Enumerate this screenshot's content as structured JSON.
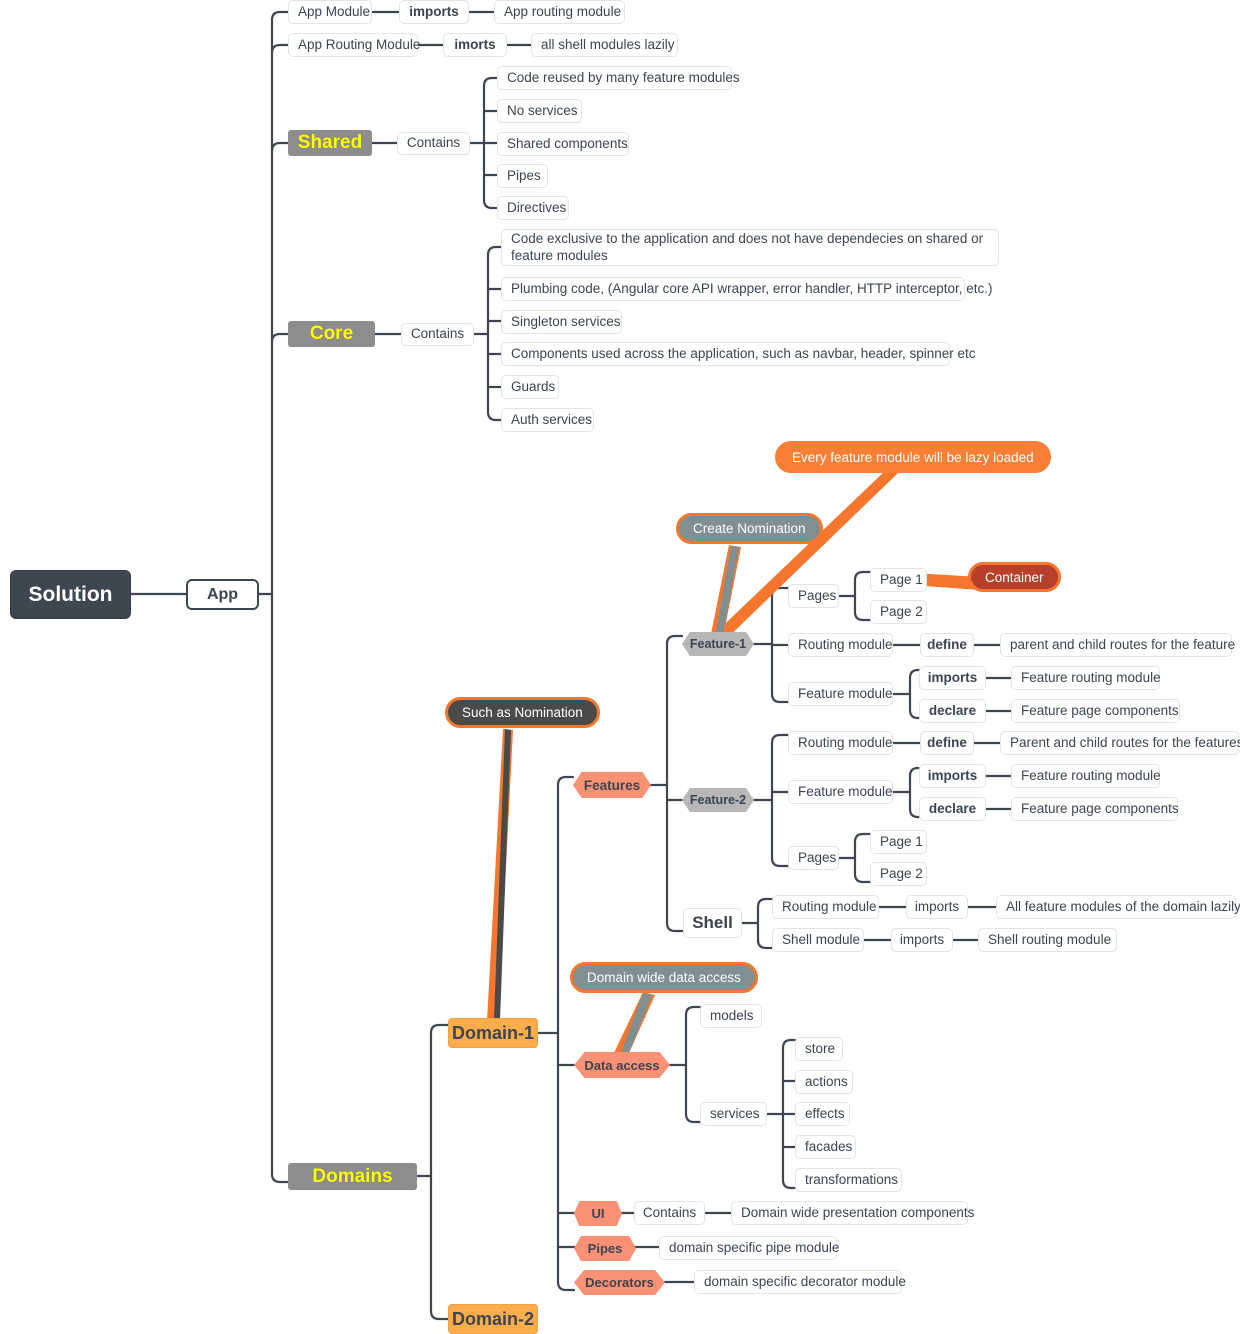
{
  "diagram": {
    "title": "Solution architecture mind map",
    "root": {
      "label": "Solution"
    },
    "app": {
      "label": "App"
    }
  },
  "colors": {
    "accent_orange": "#F5762C",
    "callout_orange": "#F97F37",
    "callout_slate": "#7F8F92",
    "callout_dark": "#4A4A48",
    "callout_brick": "#B7402C",
    "hex_coral": "#FA9175",
    "hex_gray": "#B7B7B7",
    "section_gray": "#8D8D8D",
    "section_text_yellow": "#FFFF00",
    "orange_rect": "#FBAC4B",
    "root_dark": "#3D4752",
    "line": "#3E4751",
    "text": "#3B4552"
  },
  "app_branch": {
    "app_module": {
      "label": "App Module"
    },
    "app_module_rel": {
      "label": "imports"
    },
    "app_module_target": {
      "label": "App routing module"
    },
    "app_routing_module": {
      "label": "App Routing Module"
    },
    "app_routing_rel": {
      "label": "imorts"
    },
    "app_routing_target": {
      "label": "all shell modules lazily"
    }
  },
  "shared": {
    "label": "Shared",
    "relation": "Contains",
    "items": [
      "Code reused by many feature modules",
      "No services",
      "Shared components",
      "Pipes",
      "Directives"
    ]
  },
  "core": {
    "label": "Core",
    "relation": "Contains",
    "items": [
      "Code exclusive to the application and does not have dependecies on shared or feature modules",
      "Plumbing code, (Angular core API wrapper, error handler, HTTP interceptor, etc.)",
      "Singleton services",
      "Components used across the application, such as navbar, header, spinner etc",
      "Guards",
      "Auth services"
    ]
  },
  "domains": {
    "label": "Domains",
    "domain_1": {
      "label": "Domain-1"
    },
    "domain_2": {
      "label": "Domain-2"
    }
  },
  "callouts": {
    "lazy_loaded": "Every feature module will be lazy loaded",
    "create_nomination": "Create Nomination",
    "container": "Container",
    "such_as_nomination": "Such as Nomination",
    "domain_wide_data_access": "Domain wide data access"
  },
  "features": {
    "label": "Features",
    "feature_1": {
      "label": "Feature-1",
      "pages_label": "Pages",
      "pages": [
        "Page 1",
        "Page 2"
      ],
      "routing_module": "Routing module",
      "routing_rel": "define",
      "routing_target": "parent and child routes for the feature",
      "feature_module": "Feature module",
      "feature_rel_imports": "imports",
      "feature_imports_target": "Feature routing module",
      "feature_rel_declare": "declare",
      "feature_declare_target": "Feature page components"
    },
    "feature_2": {
      "label": "Feature-2",
      "routing_module": "Routing module",
      "routing_rel": "define",
      "routing_target": "Parent and child routes for the features",
      "feature_module": "Feature module",
      "feature_rel_imports": "imports",
      "feature_imports_target": "Feature routing module",
      "feature_rel_declare": "declare",
      "feature_declare_target": "Feature page components",
      "pages_label": "Pages",
      "pages": [
        "Page 1",
        "Page 2"
      ]
    },
    "shell": {
      "label": "Shell",
      "routing_module": "Routing module",
      "routing_rel": "imports",
      "routing_target": "All feature modules of the domain lazily",
      "shell_module": "Shell module",
      "shell_rel": "imports",
      "shell_target": "Shell routing module"
    }
  },
  "data_access": {
    "label": "Data access",
    "models": "models",
    "services": "services",
    "service_items": [
      "store",
      "actions",
      "effects",
      "facades",
      "transformations"
    ]
  },
  "ui": {
    "label": "UI",
    "relation": "Contains",
    "target": "Domain wide presentation components"
  },
  "pipes": {
    "label": "Pipes",
    "target": "domain specific pipe module"
  },
  "decorators": {
    "label": "Decorators",
    "target": "domain specific decorator module"
  }
}
